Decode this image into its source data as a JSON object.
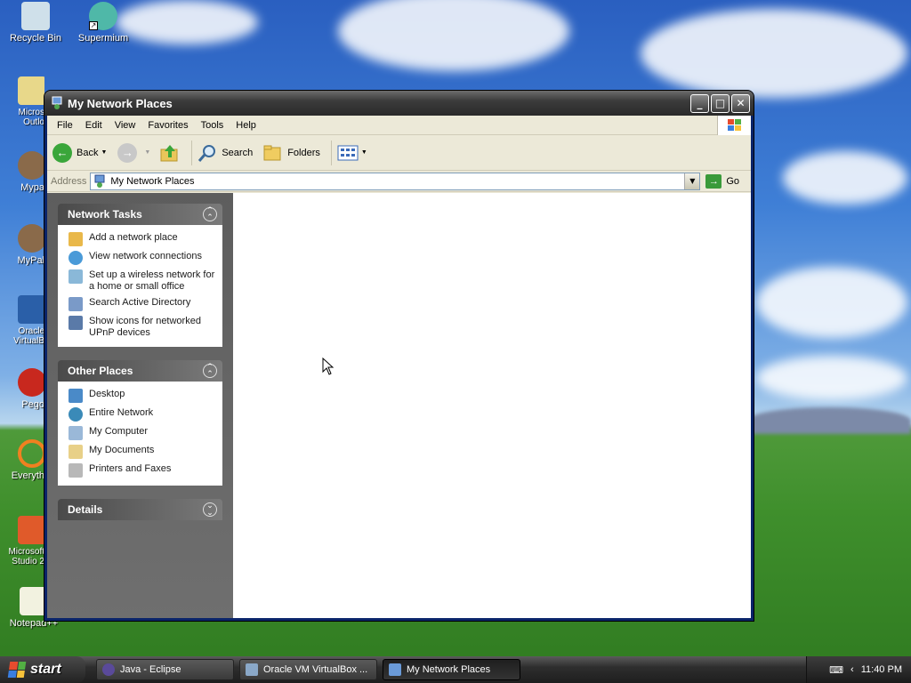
{
  "desktop": {
    "icons": [
      {
        "label": "Recycle Bin"
      },
      {
        "label": "Supermium"
      },
      {
        "label": "Micros Outlo"
      },
      {
        "label": "Mypa"
      },
      {
        "label": "MyPal"
      },
      {
        "label": "Oracle VirtualB"
      },
      {
        "label": "Pego"
      },
      {
        "label": "Everyth"
      },
      {
        "label": "Microsoft Studio 2"
      },
      {
        "label": "Notepad++"
      }
    ]
  },
  "window": {
    "title": "My Network Places",
    "menu": [
      "File",
      "Edit",
      "View",
      "Favorites",
      "Tools",
      "Help"
    ],
    "toolbar": {
      "back_label": "Back",
      "search_label": "Search",
      "folders_label": "Folders"
    },
    "address": {
      "label": "Address",
      "value": "My Network Places",
      "go_label": "Go"
    },
    "network_tasks": {
      "title": "Network Tasks",
      "items": [
        {
          "label": "Add a network place"
        },
        {
          "label": "View network connections"
        },
        {
          "label": "Set up a wireless network for a home or small office"
        },
        {
          "label": "Search Active Directory"
        },
        {
          "label": "Show icons for networked UPnP devices"
        }
      ]
    },
    "other_places": {
      "title": "Other Places",
      "items": [
        {
          "label": "Desktop"
        },
        {
          "label": "Entire Network"
        },
        {
          "label": "My Computer"
        },
        {
          "label": "My Documents"
        },
        {
          "label": "Printers and Faxes"
        }
      ]
    },
    "details": {
      "title": "Details"
    }
  },
  "taskbar": {
    "start_label": "start",
    "buttons": [
      {
        "label": "Java - Eclipse"
      },
      {
        "label": "Oracle VM VirtualBox ..."
      },
      {
        "label": "My Network Places"
      }
    ],
    "clock": "11:40 PM"
  },
  "colors": {
    "titlebar": "#3c3c3c",
    "taskpane": "#666666",
    "link_text": "#1a1a1a"
  }
}
